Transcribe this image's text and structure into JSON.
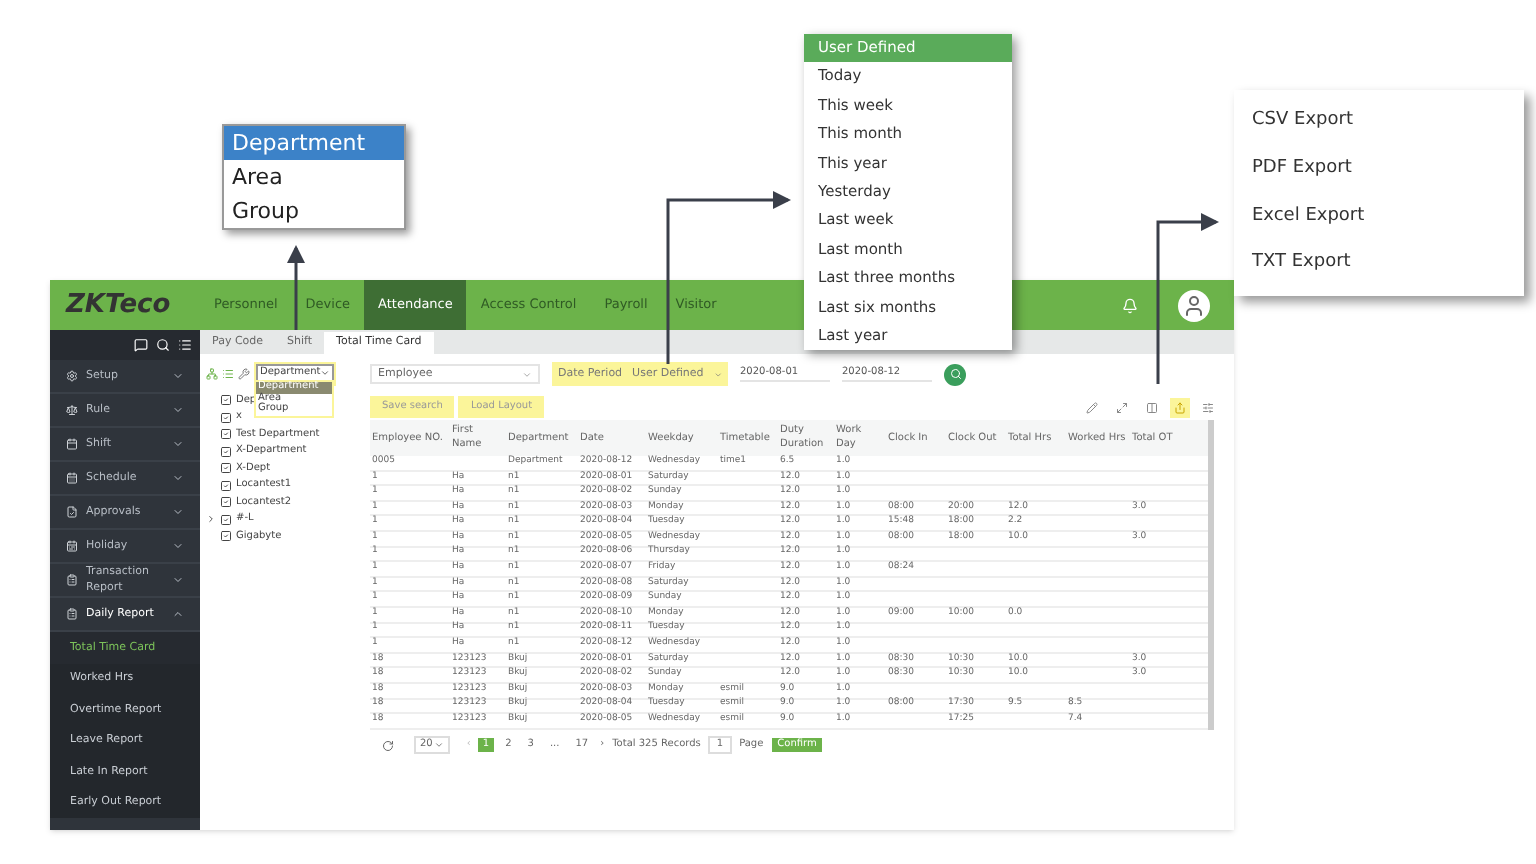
{
  "callouts": {
    "group_menu": [
      {
        "label": "Department",
        "selected": true
      },
      {
        "label": "Area",
        "selected": false
      },
      {
        "label": "Group",
        "selected": false
      }
    ],
    "date_menu": [
      {
        "label": "User Defined",
        "selected": true
      },
      {
        "label": "Today",
        "selected": false
      },
      {
        "label": "This week",
        "selected": false
      },
      {
        "label": "This month",
        "selected": false
      },
      {
        "label": "This year",
        "selected": false
      },
      {
        "label": "Yesterday",
        "selected": false
      },
      {
        "label": "Last week",
        "selected": false
      },
      {
        "label": "Last month",
        "selected": false
      },
      {
        "label": "Last three months",
        "selected": false
      },
      {
        "label": "Last six months",
        "selected": false
      },
      {
        "label": "Last year",
        "selected": false
      }
    ],
    "export_menu": [
      "CSV Export",
      "PDF Export",
      "Excel Export",
      "TXT Export"
    ]
  },
  "nav": {
    "logo": "ZKTeco",
    "items": [
      {
        "label": "Personnel",
        "selected": false
      },
      {
        "label": "Device",
        "selected": false
      },
      {
        "label": "Attendance",
        "selected": true
      },
      {
        "label": "Access Control",
        "selected": false
      },
      {
        "label": "Payroll",
        "selected": false
      },
      {
        "label": "Visitor",
        "selected": false
      }
    ]
  },
  "sidebar": {
    "items": [
      {
        "label": "Setup",
        "expanded": false
      },
      {
        "label": "Rule",
        "expanded": false
      },
      {
        "label": "Shift",
        "expanded": false
      },
      {
        "label": "Schedule",
        "expanded": false
      },
      {
        "label": "Approvals",
        "expanded": false
      },
      {
        "label": "Holiday",
        "expanded": false
      },
      {
        "label": "Transaction Report",
        "expanded": false
      },
      {
        "label": "Daily Report",
        "expanded": true,
        "children": [
          {
            "label": "Total Time Card",
            "selected": true
          },
          {
            "label": "Worked Hrs",
            "selected": false
          },
          {
            "label": "Overtime Report",
            "selected": false
          },
          {
            "label": "Leave Report",
            "selected": false
          },
          {
            "label": "Late In Report",
            "selected": false
          },
          {
            "label": "Early Out Report",
            "selected": false
          }
        ]
      }
    ]
  },
  "tabs": [
    {
      "label": "Pay Code",
      "selected": false
    },
    {
      "label": "Shift",
      "selected": false
    },
    {
      "label": "Total Time Card",
      "selected": true
    }
  ],
  "tree": {
    "select": "Department",
    "options": [
      {
        "label": "Department",
        "selected": true
      },
      {
        "label": "Area",
        "selected": false
      },
      {
        "label": "Group",
        "selected": false
      }
    ],
    "items": [
      {
        "label": "Dep",
        "checked": true
      },
      {
        "label": "x",
        "checked": true
      },
      {
        "label": "Test Department",
        "checked": true
      },
      {
        "label": "X-Department",
        "checked": true
      },
      {
        "label": "X-Dept",
        "checked": true
      },
      {
        "label": "Locantest1",
        "checked": true
      },
      {
        "label": "Locantest2",
        "checked": true
      },
      {
        "label": "#-L",
        "checked": true,
        "expanded": false
      },
      {
        "label": "Gigabyte",
        "checked": true
      }
    ]
  },
  "filters": {
    "employee_placeholder": "Employee",
    "date_period_label": "Date Period",
    "date_period": "User Defined",
    "start": "2020-08-01",
    "end": "2020-08-12",
    "buttons": [
      "Save search",
      "Load Layout"
    ]
  },
  "table": {
    "columns": [
      "Employee NO.",
      "First Name",
      "Department",
      "Date",
      "Weekday",
      "Timetable",
      "Duty Duration",
      "Work Day",
      "Clock In",
      "Clock Out",
      "Total Hrs",
      "Worked Hrs",
      "Total OT"
    ],
    "rows": [
      [
        "0005",
        "",
        "Department",
        "2020-08-12",
        "Wednesday",
        "time1",
        "6.5",
        "1.0",
        "",
        "",
        "",
        "",
        ""
      ],
      [
        "1",
        "Ha",
        "n1",
        "2020-08-01",
        "Saturday",
        "",
        "12.0",
        "1.0",
        "",
        "",
        "",
        "",
        ""
      ],
      [
        "1",
        "Ha",
        "n1",
        "2020-08-02",
        "Sunday",
        "",
        "12.0",
        "1.0",
        "",
        "",
        "",
        "",
        ""
      ],
      [
        "1",
        "Ha",
        "n1",
        "2020-08-03",
        "Monday",
        "",
        "12.0",
        "1.0",
        "08:00",
        "20:00",
        "12.0",
        "",
        "3.0"
      ],
      [
        "1",
        "Ha",
        "n1",
        "2020-08-04",
        "Tuesday",
        "",
        "12.0",
        "1.0",
        "15:48",
        "18:00",
        "2.2",
        "",
        ""
      ],
      [
        "1",
        "Ha",
        "n1",
        "2020-08-05",
        "Wednesday",
        "",
        "12.0",
        "1.0",
        "08:00",
        "18:00",
        "10.0",
        "",
        "3.0"
      ],
      [
        "1",
        "Ha",
        "n1",
        "2020-08-06",
        "Thursday",
        "",
        "12.0",
        "1.0",
        "",
        "",
        "",
        "",
        ""
      ],
      [
        "1",
        "Ha",
        "n1",
        "2020-08-07",
        "Friday",
        "",
        "12.0",
        "1.0",
        "08:24",
        "",
        "",
        "",
        ""
      ],
      [
        "1",
        "Ha",
        "n1",
        "2020-08-08",
        "Saturday",
        "",
        "12.0",
        "1.0",
        "",
        "",
        "",
        "",
        ""
      ],
      [
        "1",
        "Ha",
        "n1",
        "2020-08-09",
        "Sunday",
        "",
        "12.0",
        "1.0",
        "",
        "",
        "",
        "",
        ""
      ],
      [
        "1",
        "Ha",
        "n1",
        "2020-08-10",
        "Monday",
        "",
        "12.0",
        "1.0",
        "09:00",
        "10:00",
        "0.0",
        "",
        ""
      ],
      [
        "1",
        "Ha",
        "n1",
        "2020-08-11",
        "Tuesday",
        "",
        "12.0",
        "1.0",
        "",
        "",
        "",
        "",
        ""
      ],
      [
        "1",
        "Ha",
        "n1",
        "2020-08-12",
        "Wednesday",
        "",
        "12.0",
        "1.0",
        "",
        "",
        "",
        "",
        ""
      ],
      [
        "18",
        "123123",
        "Bkuj",
        "2020-08-01",
        "Saturday",
        "",
        "12.0",
        "1.0",
        "08:30",
        "10:30",
        "10.0",
        "",
        "3.0"
      ],
      [
        "18",
        "123123",
        "Bkuj",
        "2020-08-02",
        "Sunday",
        "",
        "12.0",
        "1.0",
        "08:30",
        "10:30",
        "10.0",
        "",
        "3.0"
      ],
      [
        "18",
        "123123",
        "Bkuj",
        "2020-08-03",
        "Monday",
        "esmil",
        "9.0",
        "1.0",
        "",
        "",
        "",
        "",
        ""
      ],
      [
        "18",
        "123123",
        "Bkuj",
        "2020-08-04",
        "Tuesday",
        "esmil",
        "9.0",
        "1.0",
        "08:00",
        "17:30",
        "9.5",
        "8.5",
        ""
      ],
      [
        "18",
        "123123",
        "Bkuj",
        "2020-08-05",
        "Wednesday",
        "esmil",
        "9.0",
        "1.0",
        "",
        "17:25",
        "",
        "7.4",
        ""
      ]
    ]
  },
  "pager": {
    "size": "20",
    "prev": "‹",
    "pages": [
      {
        "label": "1",
        "selected": true
      },
      {
        "label": "2",
        "selected": false
      },
      {
        "label": "3",
        "selected": false
      },
      {
        "label": "...",
        "selected": false
      },
      {
        "label": "17",
        "selected": false
      }
    ],
    "next": "›",
    "total": "Total 325 Records",
    "page_value": "1",
    "page_label": "Page",
    "confirm": "Confirm"
  }
}
